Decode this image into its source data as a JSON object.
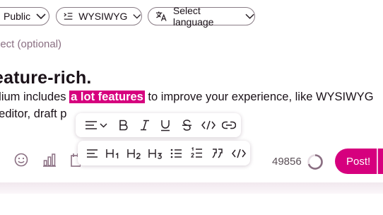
{
  "header": {
    "visibility_label": "Public",
    "editor_mode_label": "WYSIWYG",
    "language_label": "Select language"
  },
  "composer": {
    "subject_placeholder": "ject (optional)",
    "heading": "eature-rich.",
    "line1_before": "olium includes ",
    "line1_highlight": "a lot features",
    "line1_after": " to improve your experience, like WYSIWYG",
    "line2": "t editor, draft p"
  },
  "toolbar_top": {
    "items": [
      "align-menu-icon",
      "bold-icon",
      "italic-icon",
      "underline-icon",
      "strikethrough-icon",
      "code-inline-icon",
      "link-icon"
    ]
  },
  "toolbar_bottom": {
    "items": [
      "align-left-icon",
      "heading-1",
      "heading-2",
      "heading-3",
      "bullet-list-icon",
      "numbered-list-icon",
      "quote-icon",
      "code-block-icon"
    ]
  },
  "footer": {
    "char_count": "49856",
    "post_label": "Post!",
    "accent_color": "#d6007e"
  }
}
